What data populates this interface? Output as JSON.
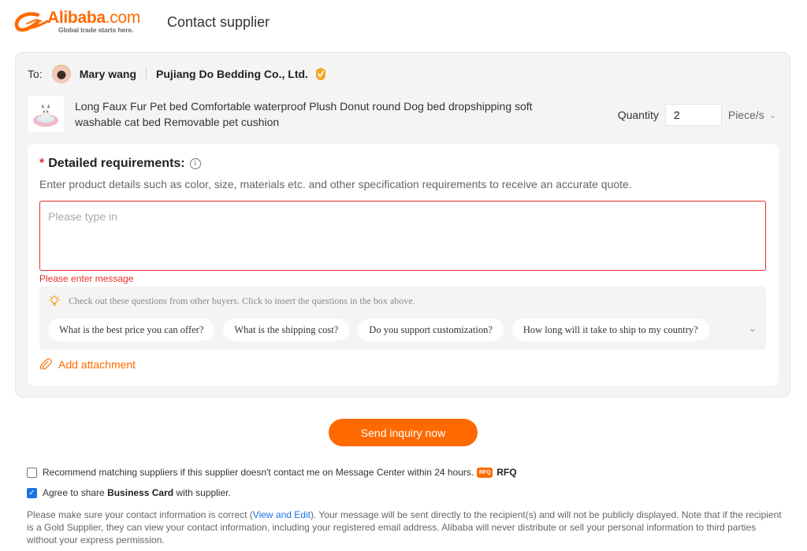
{
  "header": {
    "logo_word": "Alibaba",
    "logo_dotcom": ".com",
    "logo_tagline": "Global trade starts here.",
    "page_title": "Contact supplier"
  },
  "recipient": {
    "to_label": "To:",
    "contact_name": "Mary wang",
    "company_name": "Pujiang Do Bedding Co., Ltd.",
    "badge_icon": "gold-supplier-icon"
  },
  "product": {
    "title": "Long Faux Fur Pet bed Comfortable waterproof Plush Donut round Dog bed dropshipping soft washable cat bed Removable pet cushion",
    "quantity_label": "Quantity",
    "quantity_value": "2",
    "unit": "Piece/s"
  },
  "requirements": {
    "required_mark": "*",
    "title": "Detailed requirements:",
    "description": "Enter product details such as color, size, materials etc. and other specification requirements to receive an accurate quote.",
    "placeholder": "Please type in",
    "value": "",
    "error": "Please enter message",
    "suggest_hint": "Check out these questions from other buyers. Click to insert the questions in the box above.",
    "suggestions": [
      "What is the best price you can offer?",
      "What is the shipping cost?",
      "Do you support customization?",
      "How long will it take to ship to my country?"
    ],
    "attachment_label": "Add attachment"
  },
  "actions": {
    "send_label": "Send inquiry now"
  },
  "options": {
    "recommend": {
      "checked": false,
      "text": "Recommend matching suppliers if this supplier doesn't contact me on Message Center within 24 hours.",
      "badge": "RFQ",
      "badge_label": "RFQ"
    },
    "share_card": {
      "checked": true,
      "prefix": "Agree to share ",
      "bold": "Business Card",
      "suffix": " with supplier."
    }
  },
  "notice": {
    "before_link": "Please make sure your contact information is correct (",
    "link": "View and Edit",
    "after_link": "). Your message will be sent directly to the recipient(s) and will not be publicly displayed. Note that if the recipient is a Gold Supplier, they can view your contact information, including your registered email address. Alibaba will never distribute or sell your personal information to third parties without your express permission."
  },
  "colors": {
    "brand": "#ff6a00",
    "error": "#e62e2e",
    "link": "#1a73e8"
  }
}
